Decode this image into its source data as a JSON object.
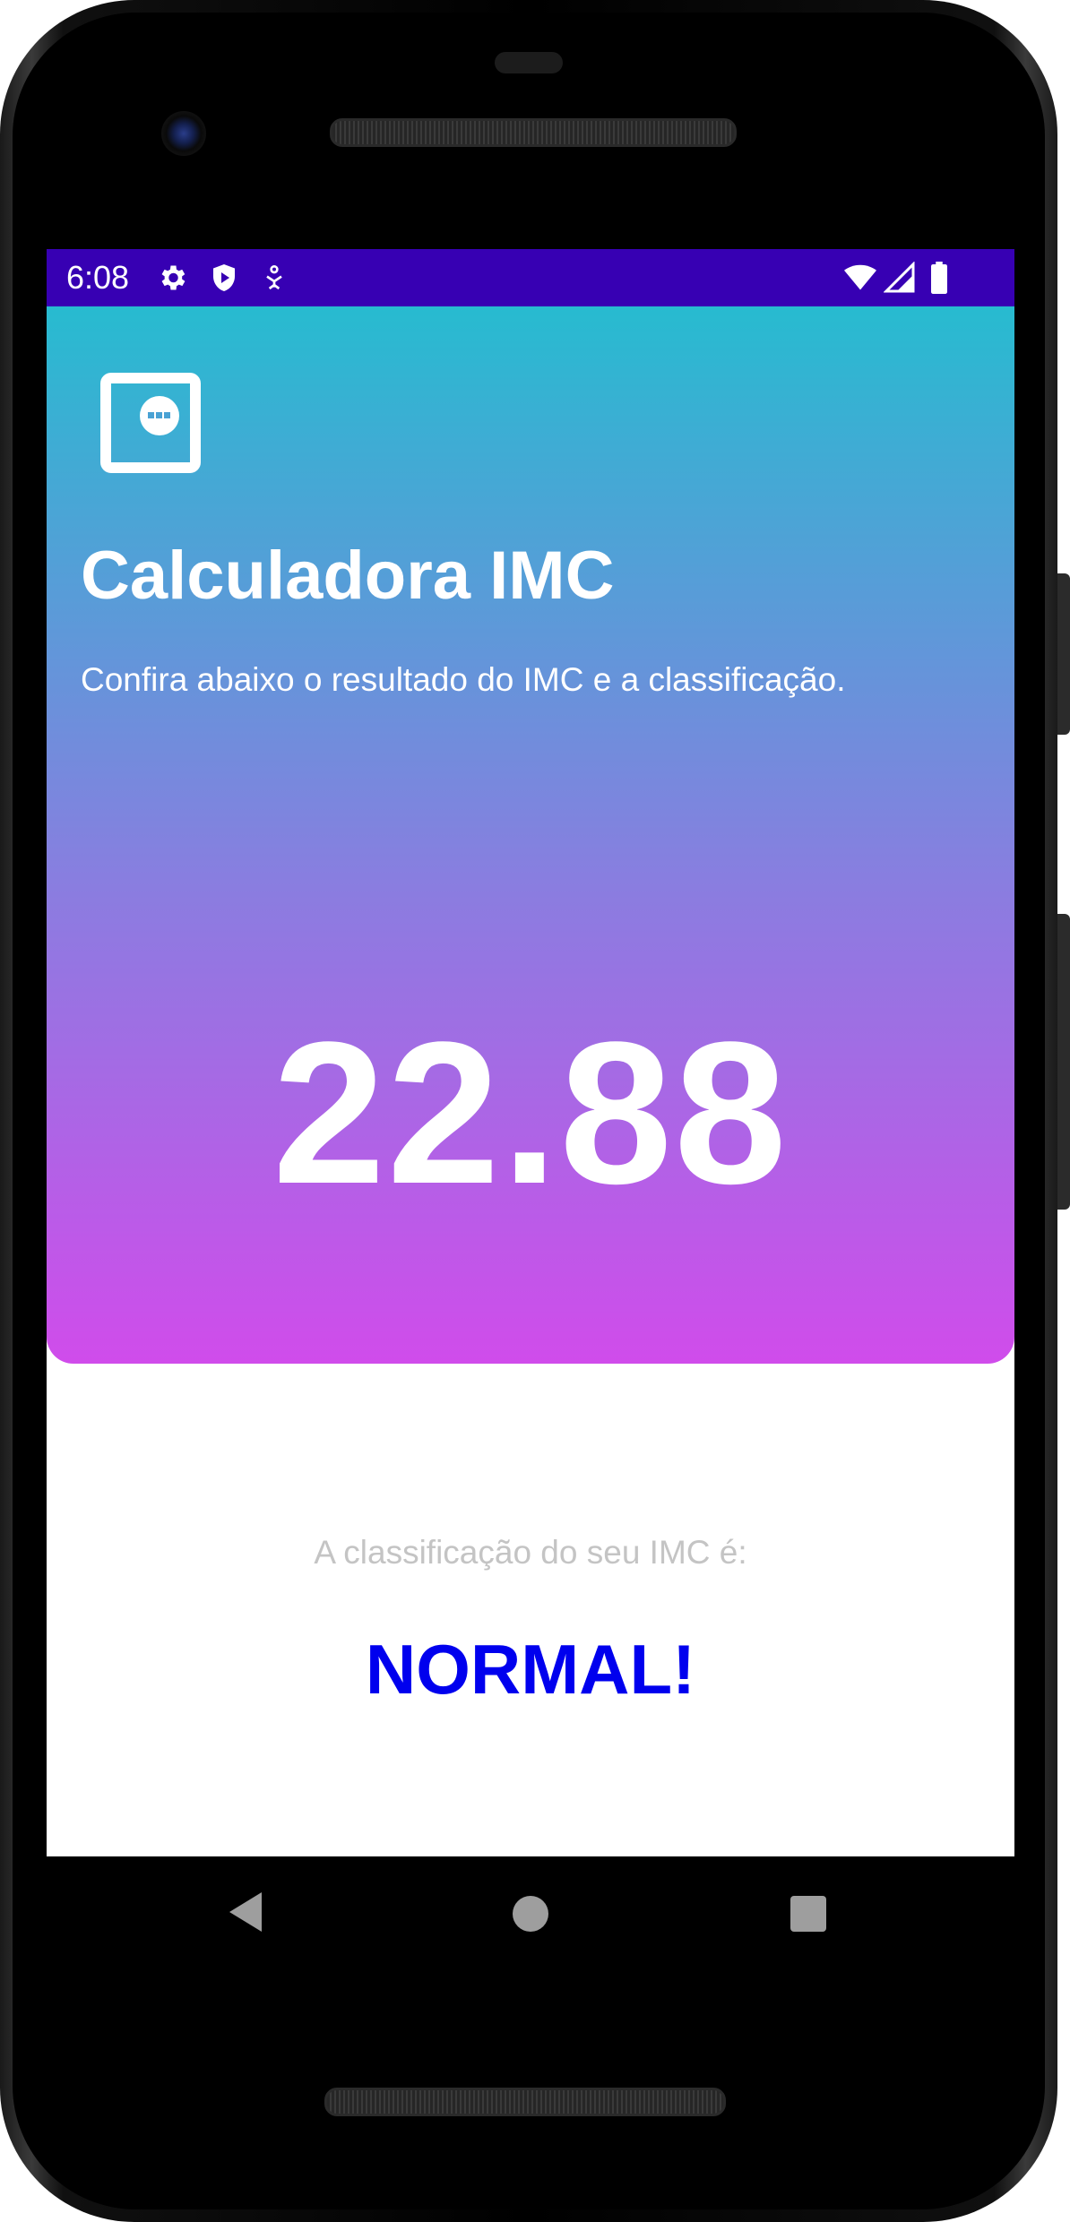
{
  "status_bar": {
    "time": "6:08",
    "icons": [
      "settings-gear-icon",
      "shield-icon",
      "accessibility-icon",
      "wifi-icon",
      "signal-icon",
      "battery-icon"
    ],
    "background_color": "#3700b3"
  },
  "header": {
    "icon": "scale-icon",
    "title": "Calculadora IMC",
    "subtitle": "Confira abaixo o resultado do IMC e a classificação.",
    "gradient": [
      "#27bbd0",
      "#d04ceb"
    ]
  },
  "result": {
    "value": "22.88"
  },
  "classification": {
    "label": "A classificação do seu IMC é:",
    "value": "NORMAL!",
    "value_color": "#0000ee"
  },
  "navigation_bar": {
    "buttons": [
      "back-icon",
      "home-icon",
      "recents-icon"
    ]
  }
}
